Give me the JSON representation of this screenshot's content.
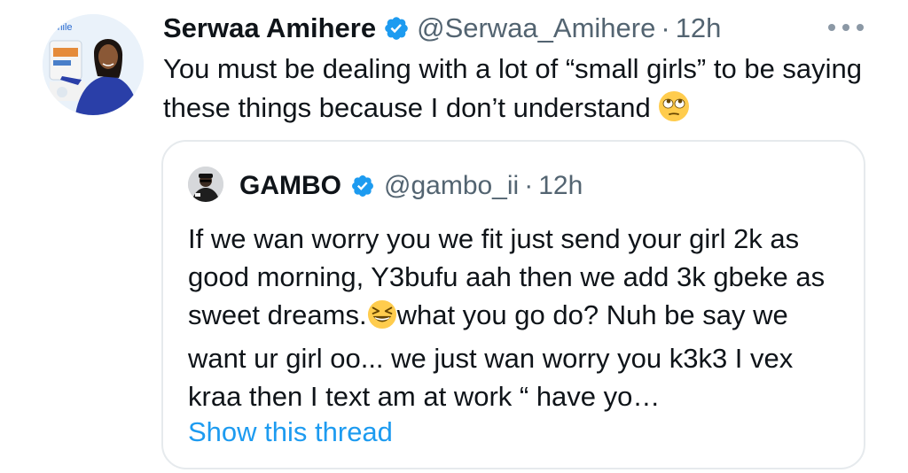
{
  "tweet": {
    "author_name": "Serwaa Amihere",
    "author_handle": "@Serwaa_Amihere",
    "separator": "·",
    "time": "12h",
    "text": "You must be dealing with a lot of “small girls” to be saying these things because I don’t understand",
    "emoji_icon": "face-with-rolling-eyes-icon"
  },
  "quoted": {
    "author_name": "GAMBO",
    "author_handle": "@gambo_ii",
    "separator": "·",
    "time": "12h",
    "text_before_emoji": "If we wan worry you we fit just send your girl 2k as good morning, Y3bufu aah then we add 3k gbeke as sweet dreams.",
    "text_after_emoji": "what you go do? Nuh be say we want ur girl oo... we just wan worry you k3k3 I vex kraa then I text am at work “ have yo…",
    "emoji_icon": "grinning-squinting-face-icon",
    "show_thread_label": "Show this thread"
  },
  "colors": {
    "verified": "#1d9bf0",
    "link": "#1d9bf0",
    "muted": "#536471",
    "text": "#0f1419",
    "border": "#e6eaed"
  }
}
